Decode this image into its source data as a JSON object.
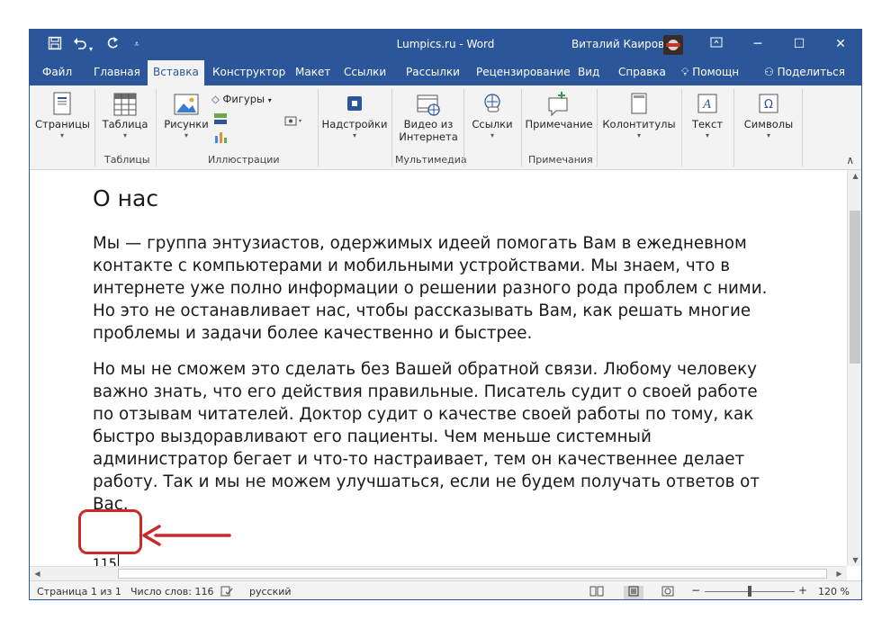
{
  "titlebar": {
    "title": "Lumpics.ru  -  Word",
    "user": "Виталий Каиров",
    "icons": {
      "save": "save-icon",
      "undo": "undo-icon",
      "redo": "redo-icon",
      "customize": "customize-qat-icon",
      "ribbon_display": "ribbon-display-icon",
      "minimize": "minimize-icon",
      "maximize": "maximize-icon",
      "close": "close-icon"
    }
  },
  "tabs": [
    {
      "label": "Файл"
    },
    {
      "label": "Главная"
    },
    {
      "label": "Вставка",
      "active": true
    },
    {
      "label": "Конструктор"
    },
    {
      "label": "Макет"
    },
    {
      "label": "Ссылки"
    },
    {
      "label": "Рассылки"
    },
    {
      "label": "Рецензирование"
    },
    {
      "label": "Вид"
    },
    {
      "label": "Справка"
    },
    {
      "label": "Помощн"
    },
    {
      "label": "Поделиться"
    }
  ],
  "ribbon": {
    "pages": "Страницы",
    "table": "Таблица",
    "pictures": "Рисунки",
    "shapes": "Фигуры",
    "addins": "Надстройки",
    "online_video": "Видео из Интернета",
    "links": "Ссылки",
    "comment": "Примечание",
    "header_footer": "Колонтитулы",
    "text": "Текст",
    "symbols": "Символы",
    "groups": {
      "tables": "Таблицы",
      "illustrations": "Иллюстрации",
      "media": "Мультимедиа",
      "comments": "Примечания"
    }
  },
  "document": {
    "heading": "О нас",
    "paragraphs": [
      "Мы — группа энтузиастов, одержимых идеей помогать Вам в ежедневном контакте с компьютерами и мобильными устройствами. Мы знаем, что в интернете уже полно информации о решении разного рода проблем с ними. Но это не останавливает нас, чтобы рассказывать Вам, как решать многие проблемы и задачи более качественно и быстрее.",
      "Но мы не сможем это сделать без Вашей обратной связи. Любому человеку важно знать, что его действия правильные. Писатель судит о своей работе по отзывам читателей. Доктор судит о качестве своей работы по тому, как быстро выздоравливают его пациенты. Чем меньше системный администратор бегает и что-то настраивает, тем он качественнее делает работу. Так и мы не можем улучшаться, если не будем получать ответов от Вас."
    ],
    "typed_number": "115"
  },
  "statusbar": {
    "page": "Страница 1 из 1",
    "words": "Число слов: 116",
    "language": "русский",
    "zoom": "120 %",
    "zoom_percent": 120
  },
  "colors": {
    "accent": "#2b579a",
    "highlight": "#cc2a2a"
  }
}
